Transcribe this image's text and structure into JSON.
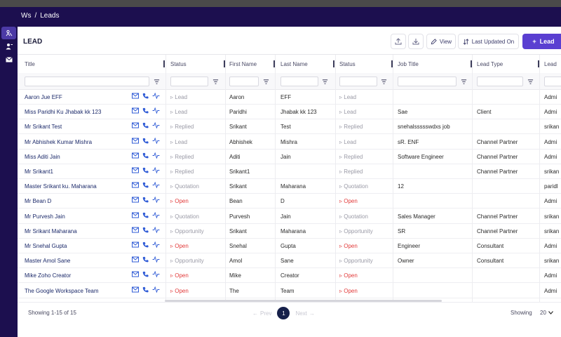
{
  "breadcrumb": {
    "workspace": "Ws",
    "separator": "/",
    "current": "Leads"
  },
  "sidebar": {
    "icons": [
      "people-icon",
      "contact-icon",
      "mail-icon"
    ]
  },
  "header": {
    "title": "LEAD",
    "view_label": "View",
    "sort_label": "Last Updated On",
    "add_label": "Lead"
  },
  "columns": [
    "Title",
    "Status",
    "First Name",
    "Last Name",
    "Status",
    "Job Title",
    "Lead Type",
    "Lead"
  ],
  "rows": [
    {
      "title": "Aaron Jue EFF",
      "status": "Lead",
      "first": "Aaron",
      "last": "EFF",
      "status2": "Lead",
      "job": "",
      "type": "",
      "owner": "Admi"
    },
    {
      "title": "Miss Paridhi Ku Jhabak kk 123",
      "status": "Lead",
      "first": "Paridhi",
      "last": "Jhabak kk 123",
      "status2": "Lead",
      "job": "Sae",
      "type": "Client",
      "owner": "Admi"
    },
    {
      "title": "Mr Srikant Test",
      "status": "Replied",
      "first": "Srikant",
      "last": "Test",
      "status2": "Replied",
      "job": "snehalssssswdxs job",
      "type": "",
      "owner": "srikan"
    },
    {
      "title": "Mr Abhishek Kumar Mishra",
      "status": "Lead",
      "first": "Abhishek",
      "last": "Mishra",
      "status2": "Lead",
      "job": "sR. ENF",
      "type": "Channel Partner",
      "owner": "Admi"
    },
    {
      "title": "Miss Aditi Jain",
      "status": "Replied",
      "first": "Aditi",
      "last": "Jain",
      "status2": "Replied",
      "job": "Software Engineer",
      "type": "Channel Partner",
      "owner": "Admi"
    },
    {
      "title": "Mr Srikant1",
      "status": "Replied",
      "first": "Srikant1",
      "last": "",
      "status2": "Replied",
      "job": "",
      "type": "Channel Partner",
      "owner": "srikan"
    },
    {
      "title": "Master Srikant ku. Maharana",
      "status": "Quotation",
      "first": "Srikant",
      "last": "Maharana",
      "status2": "Quotation",
      "job": "12",
      "type": "",
      "owner": "paridl"
    },
    {
      "title": "Mr Bean D",
      "status": "Open",
      "first": "Bean",
      "last": "D",
      "status2": "Open",
      "job": "",
      "type": "",
      "owner": "Admi"
    },
    {
      "title": "Mr Purvesh Jain",
      "status": "Quotation",
      "first": "Purvesh",
      "last": "Jain",
      "status2": "Quotation",
      "job": "Sales Manager",
      "type": "Channel Partner",
      "owner": "srikan"
    },
    {
      "title": "Mr Srikant Maharana",
      "status": "Opportunity",
      "first": "Srikant",
      "last": "Maharana",
      "status2": "Opportunity",
      "job": "SR",
      "type": "Channel Partner",
      "owner": "srikan"
    },
    {
      "title": "Mr Snehal Gupta",
      "status": "Open",
      "first": "Snehal",
      "last": "Gupta",
      "status2": "Open",
      "job": "Engineer",
      "type": "Consultant",
      "owner": "Admi"
    },
    {
      "title": "Master Amol Sane",
      "status": "Opportunity",
      "first": "Amol",
      "last": "Sane",
      "status2": "Opportunity",
      "job": "Owner",
      "type": "Consultant",
      "owner": "srikan"
    },
    {
      "title": "Mike Zoho Creator",
      "status": "Open",
      "first": "Mike",
      "last": "Creator",
      "status2": "Open",
      "job": "",
      "type": "",
      "owner": "Admi"
    },
    {
      "title": "The Google Workspace Team",
      "status": "Open",
      "first": "The",
      "last": "Team",
      "status2": "Open",
      "job": "",
      "type": "",
      "owner": "Admi"
    }
  ],
  "status_colors": {
    "Open": "#e23a3a",
    "default": "#9a9aa6"
  },
  "footer": {
    "showing_text": "Showing 1-15 of 15",
    "prev_label": "Prev",
    "page": "1",
    "next_label": "Next",
    "per_page_label": "Showing",
    "per_page_value": "20"
  },
  "colors": {
    "accent": "#5a3fd1",
    "nav": "#1c0f4f",
    "link": "#1c2a6a"
  }
}
